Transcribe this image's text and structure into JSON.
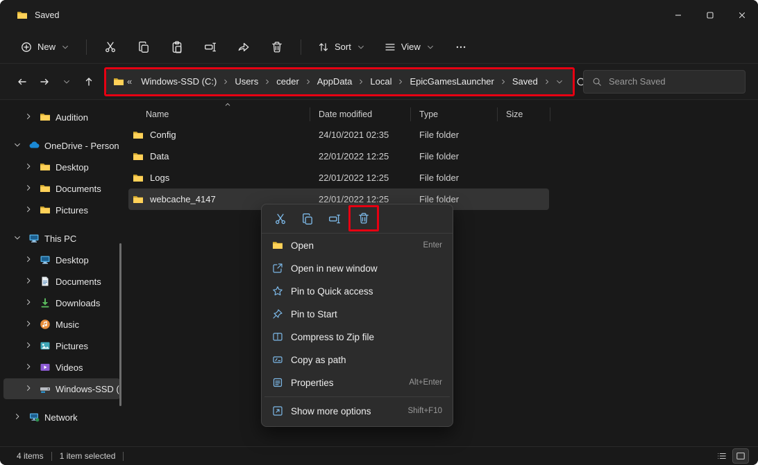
{
  "window": {
    "title": "Saved"
  },
  "toolbar": {
    "new_label": "New",
    "sort_label": "Sort",
    "view_label": "View"
  },
  "address_bar": {
    "overflow": "«",
    "crumbs": [
      "Windows-SSD (C:)",
      "Users",
      "ceder",
      "AppData",
      "Local",
      "EpicGamesLauncher",
      "Saved"
    ]
  },
  "search": {
    "placeholder": "Search Saved"
  },
  "sidebar": {
    "items": [
      {
        "label": "Audition"
      },
      {
        "label": "OneDrive - Person"
      },
      {
        "label": "Desktop"
      },
      {
        "label": "Documents"
      },
      {
        "label": "Pictures"
      },
      {
        "label": "This PC"
      },
      {
        "label": "Desktop"
      },
      {
        "label": "Documents"
      },
      {
        "label": "Downloads"
      },
      {
        "label": "Music"
      },
      {
        "label": "Pictures"
      },
      {
        "label": "Videos"
      },
      {
        "label": "Windows-SSD (C:"
      },
      {
        "label": "Network"
      }
    ]
  },
  "file_list": {
    "columns": [
      "Name",
      "Date modified",
      "Type",
      "Size"
    ],
    "rows": [
      {
        "name": "Config",
        "date_modified": "24/10/2021 02:35",
        "type": "File folder",
        "size": ""
      },
      {
        "name": "Data",
        "date_modified": "22/01/2022 12:25",
        "type": "File folder",
        "size": ""
      },
      {
        "name": "Logs",
        "date_modified": "22/01/2022 12:25",
        "type": "File folder",
        "size": ""
      },
      {
        "name": "webcache_4147",
        "date_modified": "22/01/2022 12:25",
        "type": "File folder",
        "size": ""
      }
    ]
  },
  "context_menu": {
    "items": [
      {
        "label": "Open",
        "shortcut": "Enter"
      },
      {
        "label": "Open in new window",
        "shortcut": ""
      },
      {
        "label": "Pin to Quick access",
        "shortcut": ""
      },
      {
        "label": "Pin to Start",
        "shortcut": ""
      },
      {
        "label": "Compress to Zip file",
        "shortcut": ""
      },
      {
        "label": "Copy as path",
        "shortcut": ""
      },
      {
        "label": "Properties",
        "shortcut": "Alt+Enter"
      },
      {
        "label": "Show more options",
        "shortcut": "Shift+F10"
      }
    ]
  },
  "status_bar": {
    "items_count": "4 items",
    "selection": "1 item selected"
  },
  "colors": {
    "annotation_red": "#e60012",
    "folder_yellow": "#ffd158",
    "menu_icon_blue": "#7db9e8",
    "window_bg": "#1c1c1c"
  }
}
